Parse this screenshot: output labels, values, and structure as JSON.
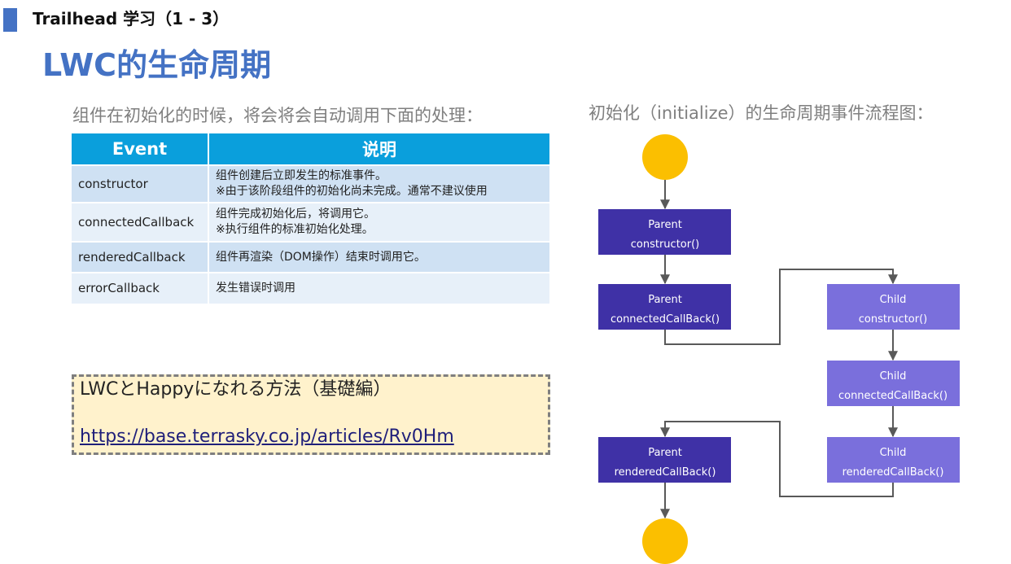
{
  "header": {
    "title": "Trailhead 学习（1 - 3）"
  },
  "page": {
    "title": "LWC的生命周期",
    "intro": "组件在初始化的时候，将会将会自动调用下面的处理：",
    "flow_caption": "初始化（initialize）的生命周期事件流程图："
  },
  "table": {
    "headers": [
      "Event",
      "说明"
    ],
    "rows": [
      {
        "event": "constructor",
        "desc": [
          "组件创建后立即发生的标准事件。",
          "※由于该阶段组件的初始化尚未完成。通常不建议使用"
        ]
      },
      {
        "event": "connectedCallback",
        "desc": [
          "组件完成初始化后，将调用它。",
          "※执行组件的标准初始化处理。"
        ]
      },
      {
        "event": "renderedCallback",
        "desc": [
          "组件再渲染（DOM操作）结束时调用它。"
        ]
      },
      {
        "event": "errorCallback",
        "desc": [
          "发生错误时调用"
        ]
      }
    ]
  },
  "link_box": {
    "title": "LWCとHappyになれる方法（基礎編）",
    "url": "https://base.terrasky.co.jp/articles/Rv0Hm"
  },
  "flow": {
    "colors": {
      "parent": "#3f31a6",
      "child": "#7a6fdc",
      "terminal": "#fbbf00",
      "line": "#595959"
    },
    "nodes": [
      {
        "id": "parent-constructor",
        "line1": "Parent",
        "line2": "constructor()"
      },
      {
        "id": "parent-connected",
        "line1": "Parent",
        "line2": "connectedCallBack()"
      },
      {
        "id": "child-constructor",
        "line1": "Child",
        "line2": "constructor()"
      },
      {
        "id": "child-connected",
        "line1": "Child",
        "line2": "connectedCallBack()"
      },
      {
        "id": "child-rendered",
        "line1": "Child",
        "line2": "renderedCallBack()"
      },
      {
        "id": "parent-rendered",
        "line1": "Parent",
        "line2": "renderedCallBack()"
      }
    ]
  }
}
